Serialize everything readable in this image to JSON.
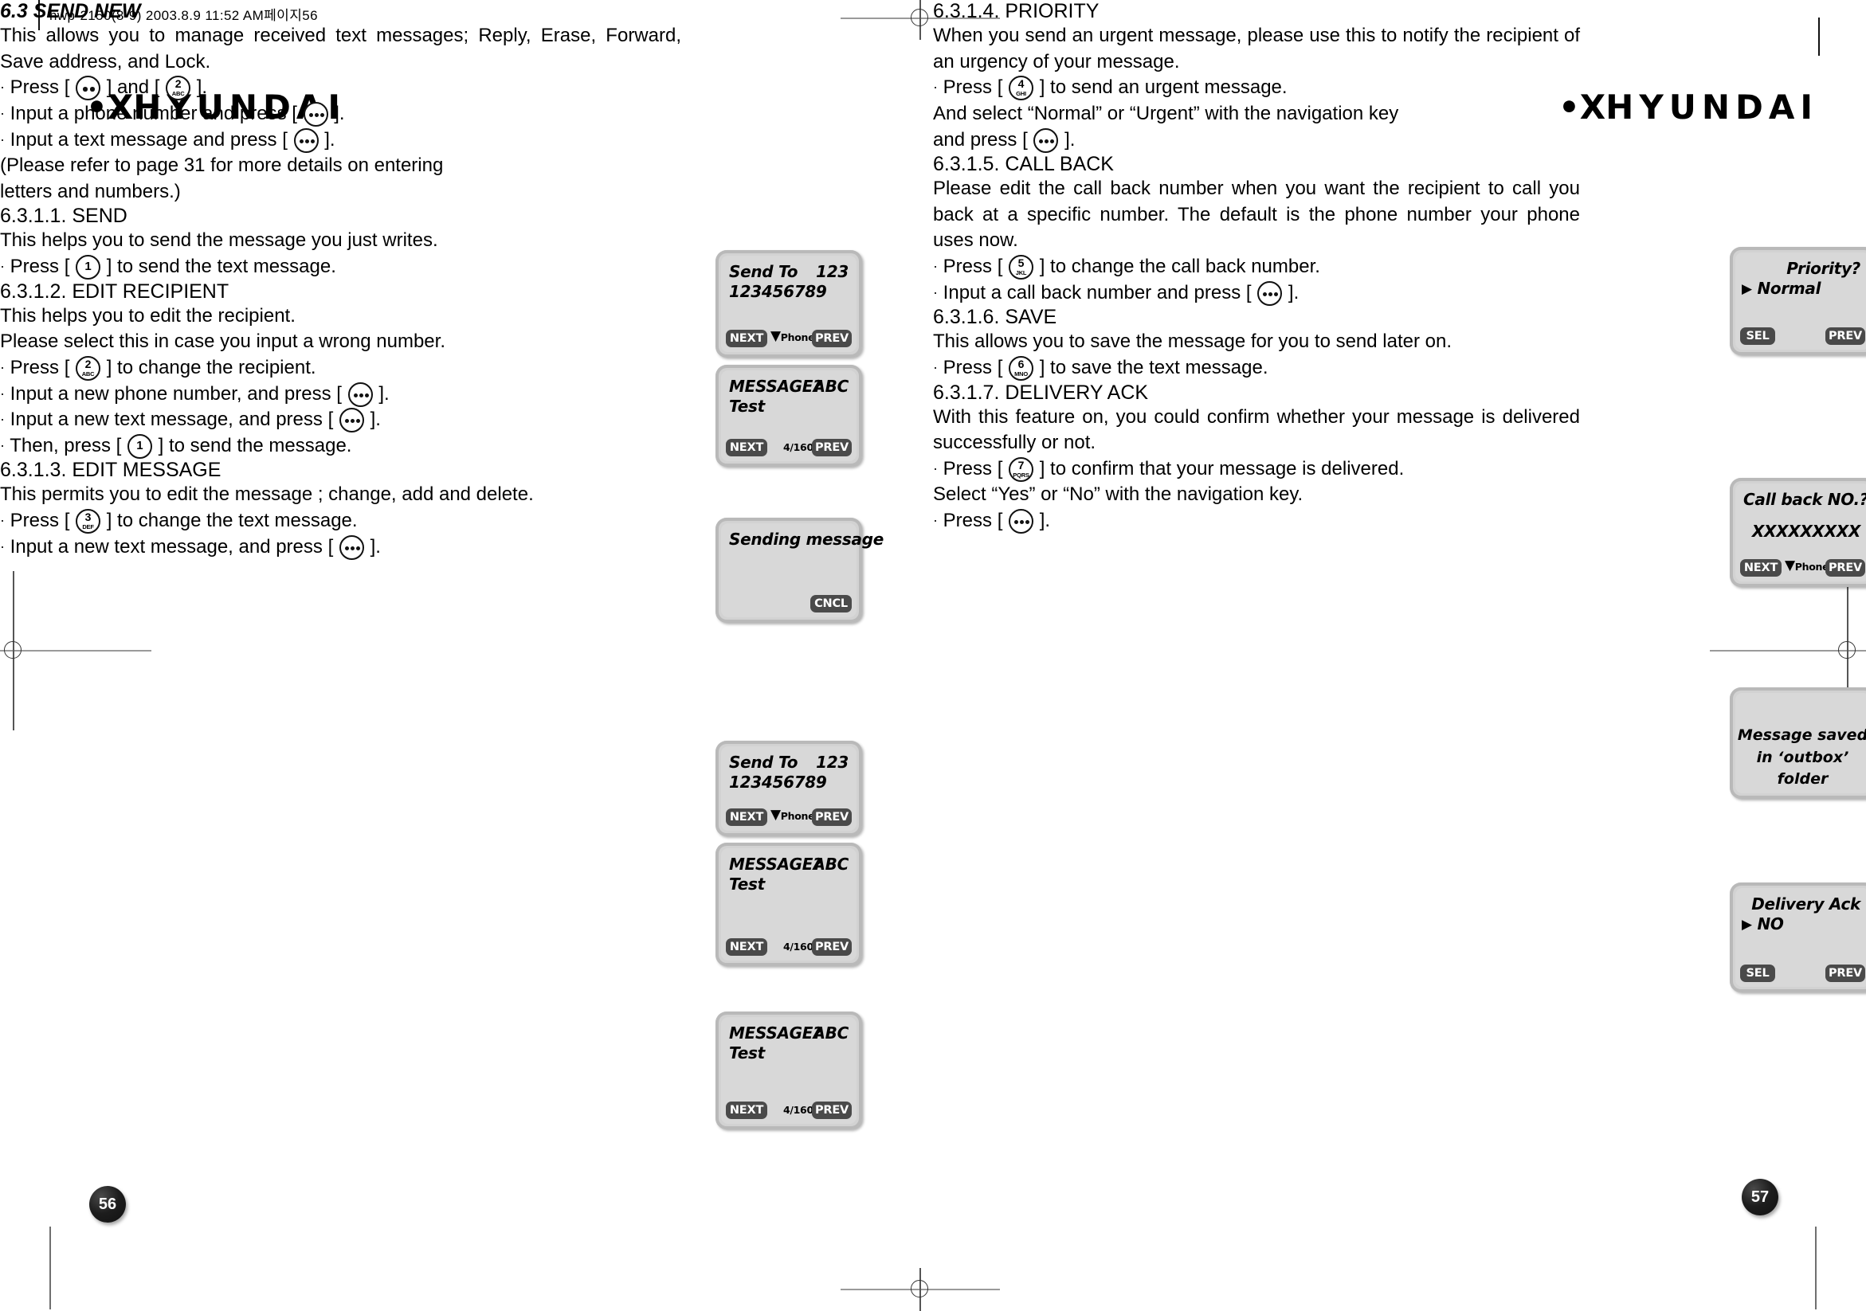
{
  "slug": "hwp-2150(8-9)  2003.8.9 11:52 AM페이지56",
  "logo": {
    "dots": "•X",
    "word": "HYUNDAI"
  },
  "left_page": {
    "page_number": "56",
    "section": {
      "title": "6.3 SEND NEW",
      "intro": "This allows you to manage received text messages; Reply, Erase, Forward, Save address, and Lock."
    },
    "bullets": [
      {
        "pre": "Press [",
        "key": "ok2",
        "mid": "] and [",
        "key2": "2",
        "post": "]."
      },
      {
        "pre": "Input a phone number and press [",
        "key": "ok3",
        "post": "]."
      },
      {
        "pre": "Input a text message and press [",
        "key": "ok3",
        "post": "]."
      }
    ],
    "note_line1": "(Please refer to page 31 for more details on entering",
    "note_line2": "letters and numbers.)",
    "sub_sections": [
      {
        "heading": "6.3.1.1. SEND",
        "desc": "This helps you to send the message you just writes.",
        "steps": [
          {
            "pre": "Press [",
            "key": "1",
            "post": "] to send the text message."
          }
        ]
      },
      {
        "heading": "6.3.1.2. EDIT RECIPIENT",
        "desc_line1": "This helps you to edit the recipient.",
        "desc_line2": "Please select this in case you input a wrong number.",
        "steps": [
          {
            "pre": "Press [",
            "key": "2",
            "post": "] to change the recipient."
          },
          {
            "pre": "Input a new phone number, and press [",
            "key": "ok3",
            "post": "]."
          },
          {
            "pre": "Input a new text message, and press [",
            "key": "ok3",
            "post": "]."
          },
          {
            "pre": "Then, press [",
            "key": "1",
            "post": "] to send the message."
          }
        ]
      },
      {
        "heading": "6.3.1.3. EDIT MESSAGE",
        "desc": "This permits you to edit the message ; change, add and delete.",
        "steps": [
          {
            "pre": "Press [",
            "key": "3",
            "post": "] to change the text message."
          },
          {
            "pre": "Input a new text message, and press [",
            "key": "ok3",
            "post": "]."
          }
        ]
      }
    ],
    "screens": [
      {
        "id": "send-to-1",
        "title": "Send To",
        "right": "123",
        "value": "123456789",
        "left_btn": "NEXT",
        "center": "Phone Book",
        "center_arrow": "▼",
        "right_btn": "PREV"
      },
      {
        "id": "message-1",
        "title": "MESSAGE?",
        "right": "ABC",
        "value": "Test",
        "left_btn": "NEXT",
        "center": "4/160",
        "right_btn": "PREV"
      },
      {
        "id": "sending",
        "title": "Sending message",
        "right_btn": "CNCL"
      },
      {
        "id": "send-to-2",
        "title": "Send To",
        "right": "123",
        "value": "123456789",
        "left_btn": "NEXT",
        "center": "Phone Book",
        "center_arrow": "▼",
        "right_btn": "PREV"
      },
      {
        "id": "message-2",
        "title": "MESSAGE?",
        "right": "ABC",
        "value": "Test",
        "left_btn": "NEXT",
        "center": "4/160",
        "right_btn": "PREV"
      },
      {
        "id": "message-3",
        "title": "MESSAGE?",
        "right": "ABC",
        "value": "Test",
        "left_btn": "NEXT",
        "center": "4/160",
        "right_btn": "PREV"
      }
    ]
  },
  "right_page": {
    "page_number": "57",
    "sub_sections": [
      {
        "heading": "6.3.1.4. PRIORITY",
        "desc": "When you send an urgent message, please use this to notify the recipient of an urgency of your message.",
        "steps": [
          {
            "pre": "Press [",
            "key": "4",
            "post": "] to send an urgent message."
          },
          {
            "plain": "And select “Normal” or “Urgent” with the navigation key"
          },
          {
            "pre": "and press [",
            "key": "ok3",
            "post": "]."
          }
        ]
      },
      {
        "heading": "6.3.1.5. CALL BACK",
        "desc": "Please edit the call back number when you want the recipient to call you back at a specific number. The default is the phone number your phone uses now.",
        "steps": [
          {
            "pre": "Press [",
            "key": "5",
            "post": "] to change the call back number."
          },
          {
            "pre": "Input a call back number and press [",
            "key": "ok3",
            "post": "]."
          }
        ]
      },
      {
        "heading": "6.3.1.6. SAVE",
        "desc": "This allows you to save the message for you to send later on.",
        "steps": [
          {
            "pre": "Press [",
            "key": "6",
            "post": "] to save the text message."
          }
        ]
      },
      {
        "heading": "6.3.1.7. DELIVERY ACK",
        "desc": "With this feature on, you could confirm whether your message is delivered successfully or not.",
        "steps": [
          {
            "pre": "Press [",
            "key": "7",
            "post": "] to confirm that your message is delivered."
          },
          {
            "plain": "Select “Yes” or “No” with the navigation key."
          },
          {
            "pre": "Press [",
            "key": "ok3",
            "post": "]."
          }
        ]
      }
    ],
    "screens": [
      {
        "id": "priority",
        "title": "Priority?",
        "value": "Normal",
        "marker": "▶",
        "left_btn": "SEL",
        "right_btn": "PREV"
      },
      {
        "id": "call-back",
        "title": "Call back NO.?",
        "value": "XXXXXXXXX",
        "left_btn": "NEXT",
        "center": "Phone Book",
        "center_arrow": "▼",
        "right_btn": "PREV"
      },
      {
        "id": "saved",
        "line1": "Message saved",
        "line2": "in ‘outbox’",
        "line3": "folder"
      },
      {
        "id": "delivery-ack",
        "title": "Delivery Ack",
        "value": "NO",
        "marker": "▶",
        "left_btn": "SEL",
        "right_btn": "PREV"
      }
    ]
  },
  "keys": {
    "1": {
      "num": "1",
      "sub": ""
    },
    "2": {
      "num": "2",
      "sub": "ABC"
    },
    "3": {
      "num": "3",
      "sub": "DEF"
    },
    "4": {
      "num": "4",
      "sub": "GHI"
    },
    "5": {
      "num": "5",
      "sub": "JKL"
    },
    "6": {
      "num": "6",
      "sub": "MNO"
    },
    "7": {
      "num": "7",
      "sub": "PQRS"
    }
  }
}
